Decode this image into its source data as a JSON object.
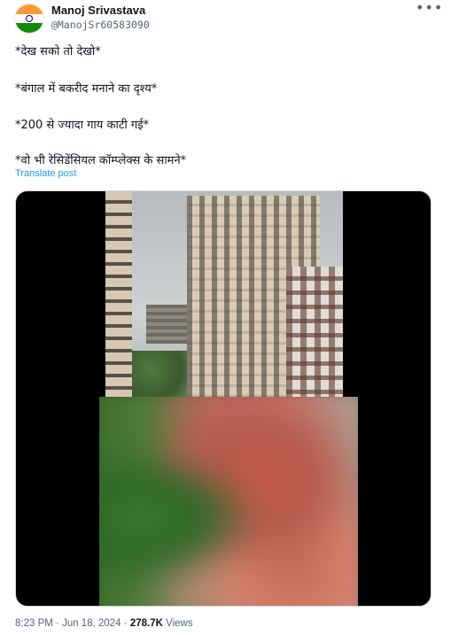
{
  "author": {
    "display_name": "Manoj Srivastava",
    "handle": "@ManojSr60583090",
    "avatar_icon": "india-flag-avatar"
  },
  "more_icon": "more-options-icon",
  "post": {
    "lines": [
      "*देख सको तो देखो*",
      "*बंगाल में बकरीद मनाने का दृश्य*",
      "*200 से ज्यादा गाय काटी गई*",
      "*वो भी रेसिडेंसियल कॉम्प्लेक्स के सामने*"
    ],
    "translate_label": "Translate post"
  },
  "meta": {
    "time": "8:23 PM",
    "sep1": " · ",
    "date": "Jun 18, 2024",
    "sep2": " · ",
    "views_count": "278.7K",
    "views_label": " Views"
  },
  "colors": {
    "link": "#1d9bf0",
    "secondary_text": "#536471",
    "primary_text": "#0f1419"
  }
}
